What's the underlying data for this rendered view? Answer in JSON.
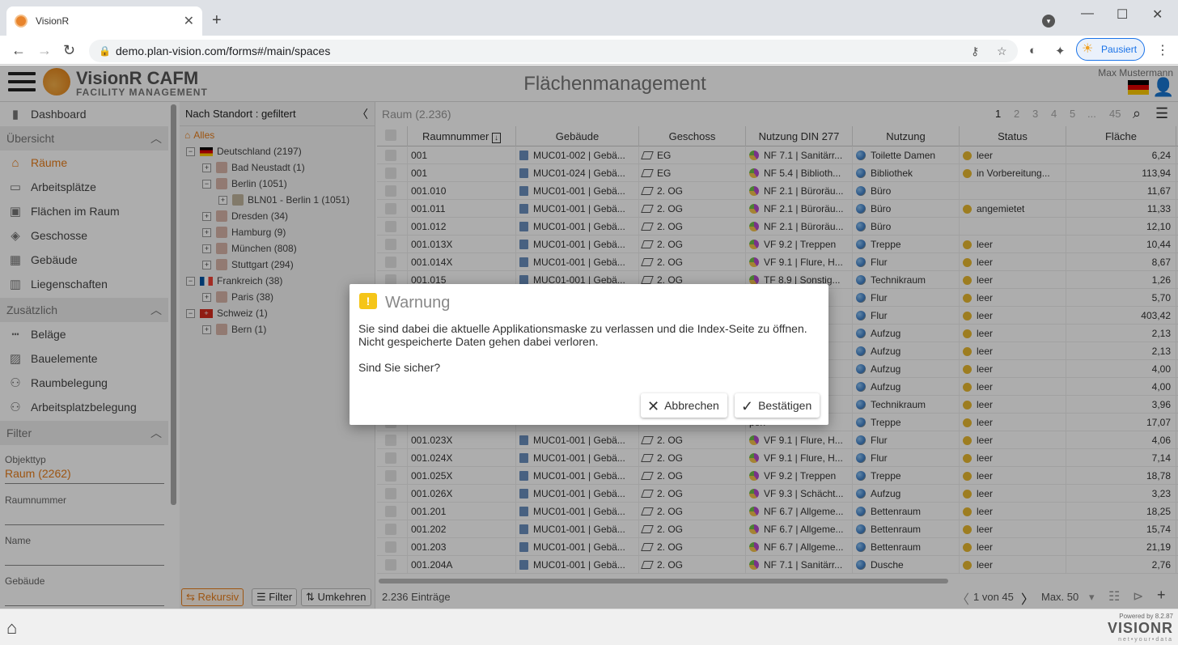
{
  "browser": {
    "tab_title": "VisionR",
    "url": "demo.plan-vision.com/forms#/main/spaces",
    "profile_label": "Pausiert"
  },
  "app": {
    "brand_name": "VisionR CAFM",
    "brand_sub": "FACILITY MANAGEMENT",
    "page_title": "Flächenmanagement",
    "user_name": "Max Mustermann"
  },
  "sidebar": {
    "dashboard": "Dashboard",
    "section_overview": "Übersicht",
    "items_overview": [
      "Räume",
      "Arbeitsplätze",
      "Flächen im Raum",
      "Geschosse",
      "Gebäude",
      "Liegenschaften"
    ],
    "section_extra": "Zusätzlich",
    "items_extra": [
      "Beläge",
      "Bauelemente",
      "Raumbelegung",
      "Arbeitsplatzbelegung"
    ],
    "section_filter": "Filter",
    "filter_type_label": "Objekttyp",
    "filter_type_value": "Raum (2262)",
    "filter_room_label": "Raumnummer",
    "filter_name_label": "Name",
    "filter_building_label": "Gebäude"
  },
  "tree": {
    "header": "Nach Standort : gefiltert",
    "all": "Alles",
    "nodes": [
      "Deutschland (2197)",
      "Bad Neustadt (1)",
      "Berlin (1051)",
      "BLN01 - Berlin 1 (1051)",
      "Dresden (34)",
      "Hamburg (9)",
      "München (808)",
      "Stuttgart (294)",
      "Frankreich (38)",
      "Paris (38)",
      "Schweiz (1)",
      "Bern (1)"
    ],
    "btn_recursive": "Rekursiv",
    "btn_filter": "Filter",
    "btn_invert": "Umkehren"
  },
  "grid": {
    "title": "Raum (2.236)",
    "pages": [
      "1",
      "2",
      "3",
      "4",
      "5",
      "...",
      "45"
    ],
    "columns": [
      "Raumnummer",
      "Gebäude",
      "Geschoss",
      "Nutzung DIN 277",
      "Nutzung",
      "Status",
      "Fläche"
    ],
    "rows": [
      [
        "001",
        "MUC01-002 | Gebä...",
        "EG",
        "NF 7.1 | Sanitärr...",
        "Toilette Damen",
        "leer",
        "6,24"
      ],
      [
        "001",
        "MUC01-024 | Gebä...",
        "EG",
        "NF 5.4 | Biblioth...",
        "Bibliothek",
        "in Vorbereitung...",
        "113,94"
      ],
      [
        "001.010",
        "MUC01-001 | Gebä...",
        "2. OG",
        "NF 2.1 | Büroräu...",
        "Büro",
        "",
        "11,67"
      ],
      [
        "001.011",
        "MUC01-001 | Gebä...",
        "2. OG",
        "NF 2.1 | Büroräu...",
        "Büro",
        "angemietet",
        "11,33"
      ],
      [
        "001.012",
        "MUC01-001 | Gebä...",
        "2. OG",
        "NF 2.1 | Büroräu...",
        "Büro",
        "",
        "12,10"
      ],
      [
        "001.013X",
        "MUC01-001 | Gebä...",
        "2. OG",
        "VF 9.2 | Treppen",
        "Treppe",
        "leer",
        "10,44"
      ],
      [
        "001.014X",
        "MUC01-001 | Gebä...",
        "2. OG",
        "VF 9.1 | Flure, H...",
        "Flur",
        "leer",
        "8,67"
      ],
      [
        "001.015",
        "MUC01-001 | Gebä...",
        "2. OG",
        "TF 8.9 | Sonstig...",
        "Technikraum",
        "leer",
        "1,26"
      ],
      [
        "",
        "",
        "",
        "H...",
        "Flur",
        "leer",
        "5,70"
      ],
      [
        "",
        "",
        "",
        "H...",
        "Flur",
        "leer",
        "403,42"
      ],
      [
        "",
        "",
        "",
        "chächt...",
        "Aufzug",
        "leer",
        "2,13"
      ],
      [
        "",
        "",
        "",
        "chächt...",
        "Aufzug",
        "leer",
        "2,13"
      ],
      [
        "",
        "",
        "",
        "chächt...",
        "Aufzug",
        "leer",
        "4,00"
      ],
      [
        "",
        "",
        "",
        "chächt...",
        "Aufzug",
        "leer",
        "4,00"
      ],
      [
        "",
        "",
        "",
        "tig...",
        "Technikraum",
        "leer",
        "3,96"
      ],
      [
        "",
        "",
        "",
        "pen",
        "Treppe",
        "leer",
        "17,07"
      ],
      [
        "001.023X",
        "MUC01-001 | Gebä...",
        "2. OG",
        "VF 9.1 | Flure, H...",
        "Flur",
        "leer",
        "4,06"
      ],
      [
        "001.024X",
        "MUC01-001 | Gebä...",
        "2. OG",
        "VF 9.1 | Flure, H...",
        "Flur",
        "leer",
        "7,14"
      ],
      [
        "001.025X",
        "MUC01-001 | Gebä...",
        "2. OG",
        "VF 9.2 | Treppen",
        "Treppe",
        "leer",
        "18,78"
      ],
      [
        "001.026X",
        "MUC01-001 | Gebä...",
        "2. OG",
        "VF 9.3 | Schächt...",
        "Aufzug",
        "leer",
        "3,23"
      ],
      [
        "001.201",
        "MUC01-001 | Gebä...",
        "2. OG",
        "NF 6.7 | Allgeme...",
        "Bettenraum",
        "leer",
        "18,25"
      ],
      [
        "001.202",
        "MUC01-001 | Gebä...",
        "2. OG",
        "NF 6.7 | Allgeme...",
        "Bettenraum",
        "leer",
        "15,74"
      ],
      [
        "001.203",
        "MUC01-001 | Gebä...",
        "2. OG",
        "NF 6.7 | Allgeme...",
        "Bettenraum",
        "leer",
        "21,19"
      ],
      [
        "001.204A",
        "MUC01-001 | Gebä...",
        "2. OG",
        "NF 7.1 | Sanitärr...",
        "Dusche",
        "leer",
        "2,76"
      ]
    ],
    "footer_count": "2.236 Einträge",
    "footer_page": "1 von 45",
    "footer_max": "Max. 50"
  },
  "powered": {
    "version": "8.2.87",
    "text": "Powered by",
    "name": "VISIONR",
    "tagline": "net•your•data"
  },
  "dialog": {
    "title": "Warnung",
    "line1": "Sie sind dabei die aktuelle Applikationsmaske zu verlassen und die Index-Seite zu öffnen.",
    "line2": "Nicht gespeicherte Daten gehen dabei verloren.",
    "line3": "Sind Sie sicher?",
    "cancel": "Abbrechen",
    "confirm": "Bestätigen"
  }
}
